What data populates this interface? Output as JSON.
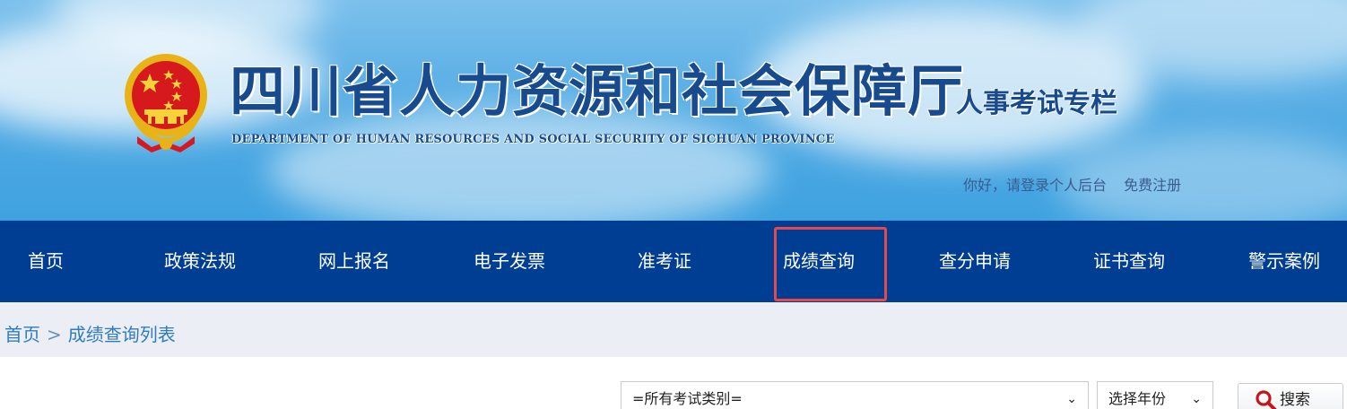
{
  "header": {
    "org_name": "四川省人力资源和社会保障厅",
    "org_name_en": "DEPARTMENT OF HUMAN RESOURCES AND SOCIAL SECURITY OF SICHUAN PROVINCE",
    "column_title": "人事考试专栏",
    "login_link": "你好，请登录个人后台",
    "register_link": "免费注册",
    "emblem_icon": "national-emblem-icon"
  },
  "nav": {
    "active": "成绩查询",
    "highlight_color": "#e5484d",
    "background": "#003e94",
    "items": [
      "首页",
      "政策法规",
      "网上报名",
      "电子发票",
      "准考证",
      "成绩查询",
      "查分申请",
      "证书查询",
      "警示案例"
    ]
  },
  "breadcrumb": {
    "home": "首页",
    "separator": ">",
    "current": "成绩查询列表"
  },
  "filters": {
    "exam_category": "=所有考试类别=",
    "year": "选择年份",
    "search_label": "搜索",
    "search_icon": "magnifier-icon"
  }
}
